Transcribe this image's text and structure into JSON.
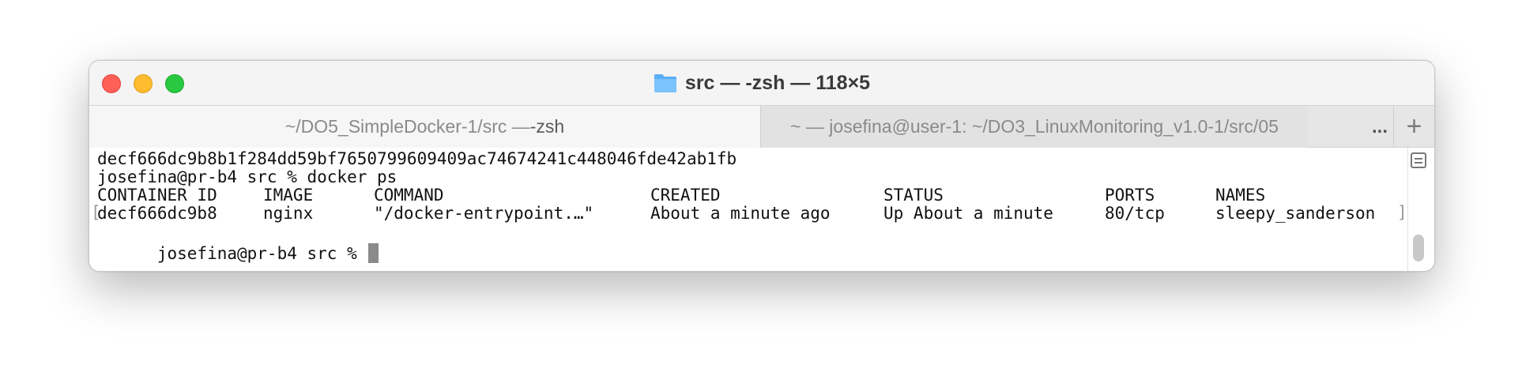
{
  "window": {
    "title": "src — -zsh — 118×5"
  },
  "tabs": [
    {
      "label_main": "~/DO5_SimpleDocker-1/src — ",
      "label_cmd": "-zsh",
      "active": true
    },
    {
      "label_main": "~ — josefina@user-1: ~/DO3_LinuxMonitoring_v1.0-1/src/05",
      "active": false
    }
  ],
  "tabbar": {
    "overflow": "...",
    "new_tab": "+"
  },
  "terminal": {
    "line1": "decf666dc9b8b1f284dd59bf7650799609409ac74674241c448046fde42ab1fb",
    "line2": "josefina@pr-b4 src % docker ps",
    "headers": [
      "CONTAINER ID",
      "IMAGE",
      "COMMAND",
      "CREATED",
      "STATUS",
      "PORTS",
      "NAMES"
    ],
    "row": [
      "decf666dc9b8",
      "nginx",
      "\"/docker-entrypoint.…\"",
      "About a minute ago",
      "Up About a minute",
      "80/tcp",
      "sleepy_sanderson"
    ],
    "prompt": "josefina@pr-b4 src % ",
    "bracket_left": "[",
    "bracket_right": "]"
  },
  "icons": {
    "folder": "folder-icon",
    "scroll_marks": "scroll-marks-icon"
  },
  "colors": {
    "close": "#fe5f57",
    "minimize": "#febc2e",
    "zoom": "#28c840",
    "folder": "#5aaef5"
  }
}
